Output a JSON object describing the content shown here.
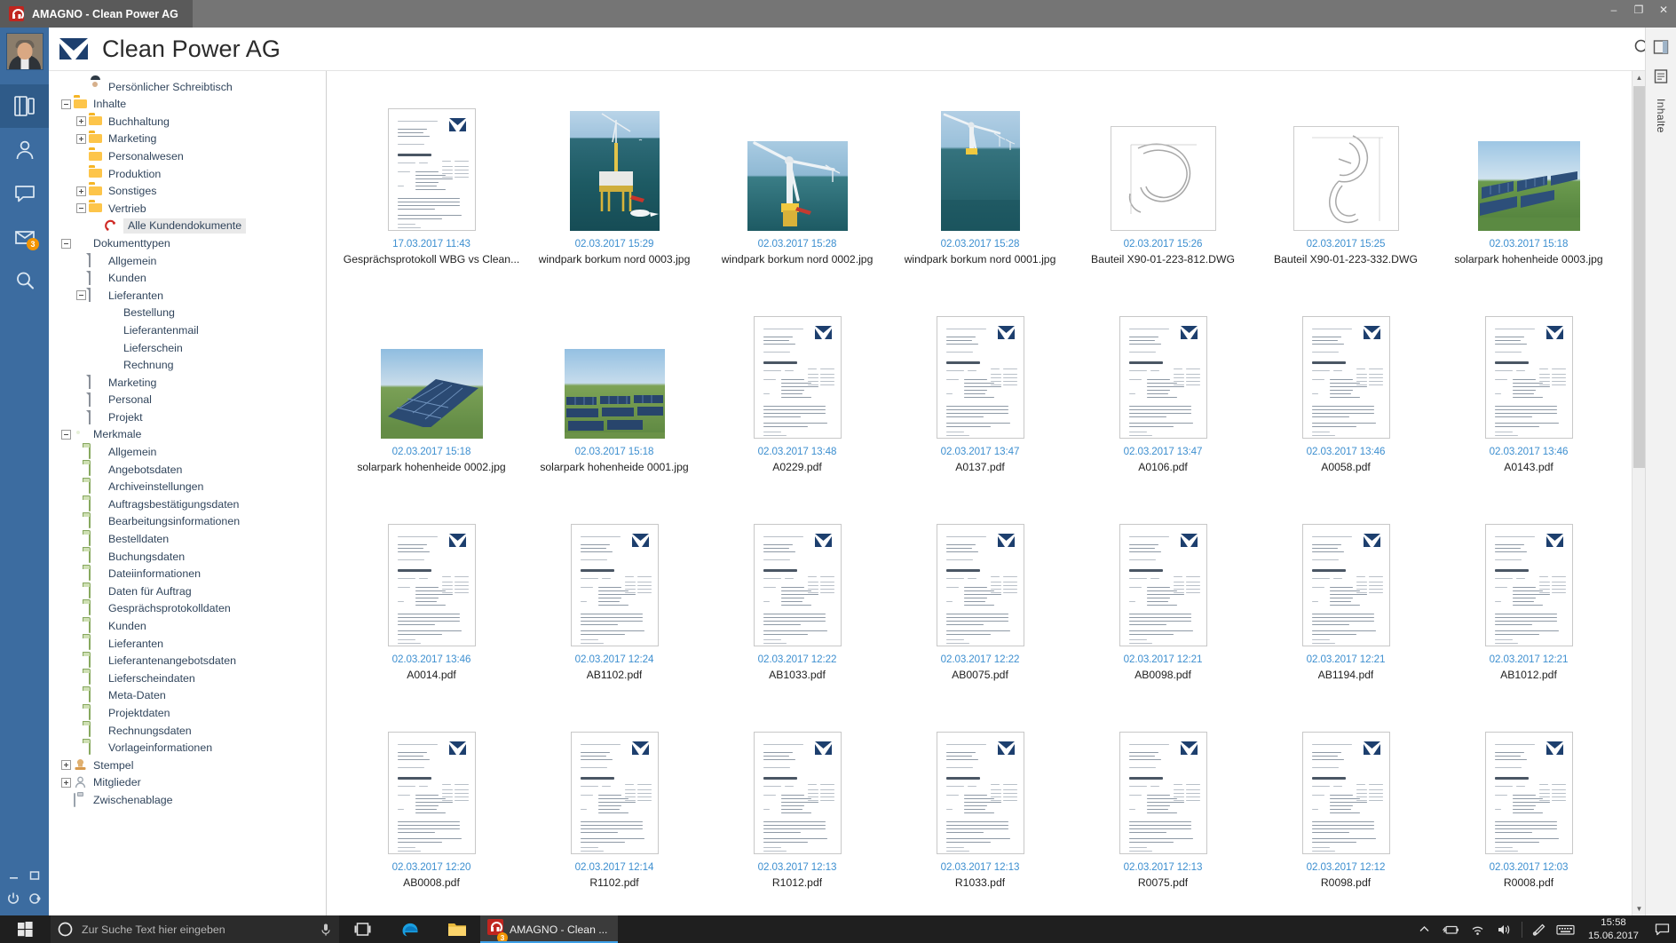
{
  "window": {
    "tab_title": "AMAGNO - Clean Power AG",
    "app_icon": "amagno-magnet-icon",
    "minimize": "–",
    "maximize": "❐",
    "close": "✕"
  },
  "header": {
    "title": "Clean Power AG",
    "logo": "amagno-logo-icon",
    "search_icon": "search-icon",
    "avatar": "user-avatar"
  },
  "rail": {
    "items": [
      {
        "name": "documents-icon",
        "selected": true,
        "badge": null
      },
      {
        "name": "contacts-icon",
        "selected": false,
        "badge": null
      },
      {
        "name": "comments-icon",
        "selected": false,
        "badge": null
      },
      {
        "name": "inbox-icon",
        "selected": false,
        "badge": "3"
      },
      {
        "name": "search-icon",
        "selected": false,
        "badge": null
      }
    ],
    "bottom": [
      "minimize-icon",
      "restore-icon",
      "power-icon",
      "logout-icon"
    ]
  },
  "right_rail": {
    "buttons": [
      "panel-toggle-icon",
      "notes-icon"
    ],
    "vertical_label": "Inhalte"
  },
  "tree": [
    {
      "label": "Persönlicher Schreibtisch",
      "depth": 1,
      "icon": "user-photo",
      "twist": "none",
      "selected": false
    },
    {
      "label": "Inhalte",
      "depth": 0,
      "icon": "folder",
      "twist": "minus",
      "selected": false
    },
    {
      "label": "Buchhaltung",
      "depth": 1,
      "icon": "folder",
      "twist": "plus",
      "selected": false
    },
    {
      "label": "Marketing",
      "depth": 1,
      "icon": "folder",
      "twist": "plus",
      "selected": false
    },
    {
      "label": "Personalwesen",
      "depth": 1,
      "icon": "folder",
      "twist": "none",
      "selected": false
    },
    {
      "label": "Produktion",
      "depth": 1,
      "icon": "folder",
      "twist": "none",
      "selected": false
    },
    {
      "label": "Sonstiges",
      "depth": 1,
      "icon": "folder",
      "twist": "plus",
      "selected": false
    },
    {
      "label": "Vertrieb",
      "depth": 1,
      "icon": "folder",
      "twist": "minus",
      "selected": false
    },
    {
      "label": "Alle Kundendokumente",
      "depth": 2,
      "icon": "swirl",
      "twist": "none",
      "selected": true
    },
    {
      "label": "Dokumenttypen",
      "depth": 0,
      "icon": "flag",
      "twist": "minus",
      "selected": false
    },
    {
      "label": "Allgemein",
      "depth": 1,
      "icon": "sheet",
      "twist": "none",
      "selected": false
    },
    {
      "label": "Kunden",
      "depth": 1,
      "icon": "sheet",
      "twist": "none",
      "selected": false
    },
    {
      "label": "Lieferanten",
      "depth": 1,
      "icon": "sheet",
      "twist": "minus",
      "selected": false
    },
    {
      "label": "Bestellung",
      "depth": 2,
      "icon": "flag",
      "twist": "none",
      "selected": false
    },
    {
      "label": "Lieferantenmail",
      "depth": 2,
      "icon": "flag",
      "twist": "none",
      "selected": false
    },
    {
      "label": "Lieferschein",
      "depth": 2,
      "icon": "flag",
      "twist": "none",
      "selected": false
    },
    {
      "label": "Rechnung",
      "depth": 2,
      "icon": "flag",
      "twist": "none",
      "selected": false
    },
    {
      "label": "Marketing",
      "depth": 1,
      "icon": "sheet",
      "twist": "none",
      "selected": false
    },
    {
      "label": "Personal",
      "depth": 1,
      "icon": "sheet",
      "twist": "none",
      "selected": false
    },
    {
      "label": "Projekt",
      "depth": 1,
      "icon": "sheet",
      "twist": "none",
      "selected": false
    },
    {
      "label": "Merkmale",
      "depth": 0,
      "icon": "tag",
      "twist": "minus",
      "selected": false
    },
    {
      "label": "Allgemein",
      "depth": 1,
      "icon": "gfolder",
      "twist": "none",
      "selected": false
    },
    {
      "label": "Angebotsdaten",
      "depth": 1,
      "icon": "gfolder",
      "twist": "none",
      "selected": false
    },
    {
      "label": "Archiveinstellungen",
      "depth": 1,
      "icon": "gfolder",
      "twist": "none",
      "selected": false
    },
    {
      "label": "Auftragsbestätigungsdaten",
      "depth": 1,
      "icon": "gfolder",
      "twist": "none",
      "selected": false
    },
    {
      "label": "Bearbeitungsinformationen",
      "depth": 1,
      "icon": "gfolder",
      "twist": "none",
      "selected": false
    },
    {
      "label": "Bestelldaten",
      "depth": 1,
      "icon": "gfolder",
      "twist": "none",
      "selected": false
    },
    {
      "label": "Buchungsdaten",
      "depth": 1,
      "icon": "gfolder",
      "twist": "none",
      "selected": false
    },
    {
      "label": "Dateiinformationen",
      "depth": 1,
      "icon": "gfolder",
      "twist": "none",
      "selected": false
    },
    {
      "label": "Daten für Auftrag",
      "depth": 1,
      "icon": "gfolder",
      "twist": "none",
      "selected": false
    },
    {
      "label": "Gesprächsprotokolldaten",
      "depth": 1,
      "icon": "gfolder",
      "twist": "none",
      "selected": false
    },
    {
      "label": "Kunden",
      "depth": 1,
      "icon": "gfolder",
      "twist": "none",
      "selected": false
    },
    {
      "label": "Lieferanten",
      "depth": 1,
      "icon": "gfolder",
      "twist": "none",
      "selected": false
    },
    {
      "label": "Lieferantenangebotsdaten",
      "depth": 1,
      "icon": "gfolder",
      "twist": "none",
      "selected": false
    },
    {
      "label": "Lieferscheindaten",
      "depth": 1,
      "icon": "gfolder",
      "twist": "none",
      "selected": false
    },
    {
      "label": "Meta-Daten",
      "depth": 1,
      "icon": "gfolder",
      "twist": "none",
      "selected": false
    },
    {
      "label": "Projektdaten",
      "depth": 1,
      "icon": "gfolder",
      "twist": "none",
      "selected": false
    },
    {
      "label": "Rechnungsdaten",
      "depth": 1,
      "icon": "gfolder",
      "twist": "none",
      "selected": false
    },
    {
      "label": "Vorlageinformationen",
      "depth": 1,
      "icon": "gfolder",
      "twist": "none",
      "selected": false
    },
    {
      "label": "Stempel",
      "depth": 0,
      "icon": "stamp",
      "twist": "plus",
      "selected": false
    },
    {
      "label": "Mitglieder",
      "depth": 0,
      "icon": "person",
      "twist": "plus",
      "selected": false
    },
    {
      "label": "Zwischenablage",
      "depth": 0,
      "icon": "clipboard",
      "twist": "none",
      "selected": false
    }
  ],
  "documents": [
    {
      "date": "17.03.2017 11:43",
      "name": "Gesprächsprotokoll WBG vs Clean...",
      "kind": "doc"
    },
    {
      "date": "02.03.2017 15:29",
      "name": "windpark borkum nord 0003.jpg",
      "kind": "photo-offshore-platform"
    },
    {
      "date": "02.03.2017 15:28",
      "name": "windpark borkum nord 0002.jpg",
      "kind": "photo-turbine-closeup"
    },
    {
      "date": "02.03.2017 15:28",
      "name": "windpark borkum nord 0001.jpg",
      "kind": "photo-turbine-sea"
    },
    {
      "date": "02.03.2017 15:26",
      "name": "Bauteil X90-01-223-812.DWG",
      "kind": "dwg-hook"
    },
    {
      "date": "02.03.2017 15:25",
      "name": "Bauteil X90-01-223-332.DWG",
      "kind": "dwg-clamp"
    },
    {
      "date": "02.03.2017 15:18",
      "name": "solarpark hohenheide 0003.jpg",
      "kind": "photo-solar-wide"
    },
    {
      "date": "02.03.2017 15:18",
      "name": "solarpark hohenheide 0002.jpg",
      "kind": "photo-solar-angle"
    },
    {
      "date": "02.03.2017 15:18",
      "name": "solarpark hohenheide 0001.jpg",
      "kind": "photo-solar-field"
    },
    {
      "date": "02.03.2017 13:48",
      "name": "A0229.pdf",
      "kind": "doc"
    },
    {
      "date": "02.03.2017 13:47",
      "name": "A0137.pdf",
      "kind": "doc"
    },
    {
      "date": "02.03.2017 13:47",
      "name": "A0106.pdf",
      "kind": "doc"
    },
    {
      "date": "02.03.2017 13:46",
      "name": "A0058.pdf",
      "kind": "doc"
    },
    {
      "date": "02.03.2017 13:46",
      "name": "A0143.pdf",
      "kind": "doc"
    },
    {
      "date": "02.03.2017 13:46",
      "name": "A0014.pdf",
      "kind": "doc"
    },
    {
      "date": "02.03.2017 12:24",
      "name": "AB1102.pdf",
      "kind": "doc"
    },
    {
      "date": "02.03.2017 12:22",
      "name": "AB1033.pdf",
      "kind": "doc"
    },
    {
      "date": "02.03.2017 12:22",
      "name": "AB0075.pdf",
      "kind": "doc"
    },
    {
      "date": "02.03.2017 12:21",
      "name": "AB0098.pdf",
      "kind": "doc"
    },
    {
      "date": "02.03.2017 12:21",
      "name": "AB1194.pdf",
      "kind": "doc"
    },
    {
      "date": "02.03.2017 12:21",
      "name": "AB1012.pdf",
      "kind": "doc"
    },
    {
      "date": "02.03.2017 12:20",
      "name": "AB0008.pdf",
      "kind": "doc"
    },
    {
      "date": "02.03.2017 12:14",
      "name": "R1102.pdf",
      "kind": "doc"
    },
    {
      "date": "02.03.2017 12:13",
      "name": "R1012.pdf",
      "kind": "doc"
    },
    {
      "date": "02.03.2017 12:13",
      "name": "R1033.pdf",
      "kind": "doc"
    },
    {
      "date": "02.03.2017 12:13",
      "name": "R0075.pdf",
      "kind": "doc"
    },
    {
      "date": "02.03.2017 12:12",
      "name": "R0098.pdf",
      "kind": "doc"
    },
    {
      "date": "02.03.2017 12:03",
      "name": "R0008.pdf",
      "kind": "doc"
    }
  ],
  "taskbar": {
    "start_icon": "windows-start-icon",
    "search_placeholder": "Zur Suche Text hier eingeben",
    "cortana_icon": "cortana-circle-icon",
    "mic_icon": "microphone-icon",
    "taskview_icon": "task-view-icon",
    "edge_icon": "edge-browser-icon",
    "explorer_icon": "file-explorer-icon",
    "app_label": "AMAGNO - Clean ...",
    "app_badge": "3",
    "tray": [
      "chevron-up-icon",
      "battery-icon",
      "wifi-icon",
      "volume-icon",
      "pen-icon",
      "keyboard-icon"
    ],
    "clock_time": "15:58",
    "clock_date": "15.06.2017",
    "notification_icon": "notification-icon"
  },
  "colors": {
    "accent_blue": "#3c6ca0",
    "date_blue": "#3d8fd0",
    "brand_red": "#c8211c",
    "folder_yellow": "#f5b526",
    "merkmale_green": "#6f9c3a"
  }
}
